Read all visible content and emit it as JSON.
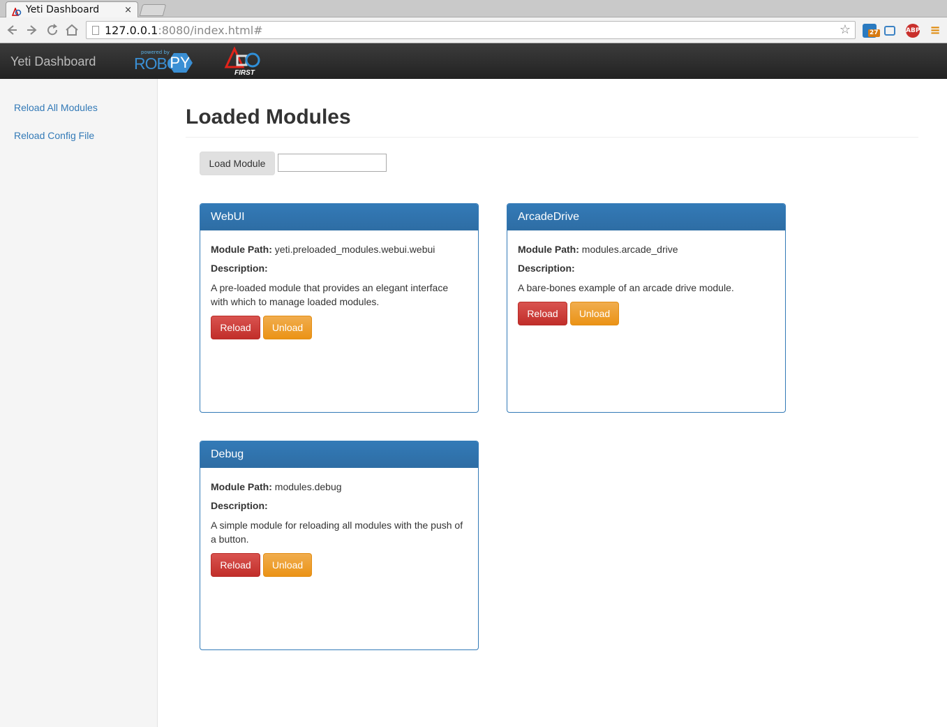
{
  "browser": {
    "tab_title": "Yeti Dashboard",
    "tab_close": "×",
    "url_host": "127.0.0.1",
    "url_rest": ":8080/index.html#",
    "badge_count": "27",
    "abp_label": "ABP"
  },
  "navbar": {
    "brand": "Yeti Dashboard",
    "robotpy_powered": "powered by",
    "robotpy_robot": "ROBOT",
    "robotpy_py": "PY",
    "first_text": "FIRST"
  },
  "sidebar": {
    "items": [
      {
        "label": "Reload All Modules"
      },
      {
        "label": "Reload Config File"
      }
    ]
  },
  "main": {
    "title": "Loaded Modules",
    "load_button": "Load Module",
    "load_input_value": "",
    "path_label": "Module Path:",
    "description_label": "Description:",
    "reload_label": "Reload",
    "unload_label": "Unload",
    "modules": [
      {
        "name": "WebUI",
        "path": "yeti.preloaded_modules.webui.webui",
        "description": "A pre-loaded module that provides an elegant interface with which to manage loaded modules."
      },
      {
        "name": "ArcadeDrive",
        "path": "modules.arcade_drive",
        "description": "A bare-bones example of an arcade drive module."
      },
      {
        "name": "Debug",
        "path": "modules.debug",
        "description": "A simple module for reloading all modules with the push of a button."
      }
    ]
  },
  "colors": {
    "primary": "#337ab7",
    "danger": "#d9534f",
    "warning": "#f0ad4e",
    "navbar": "#222222"
  }
}
